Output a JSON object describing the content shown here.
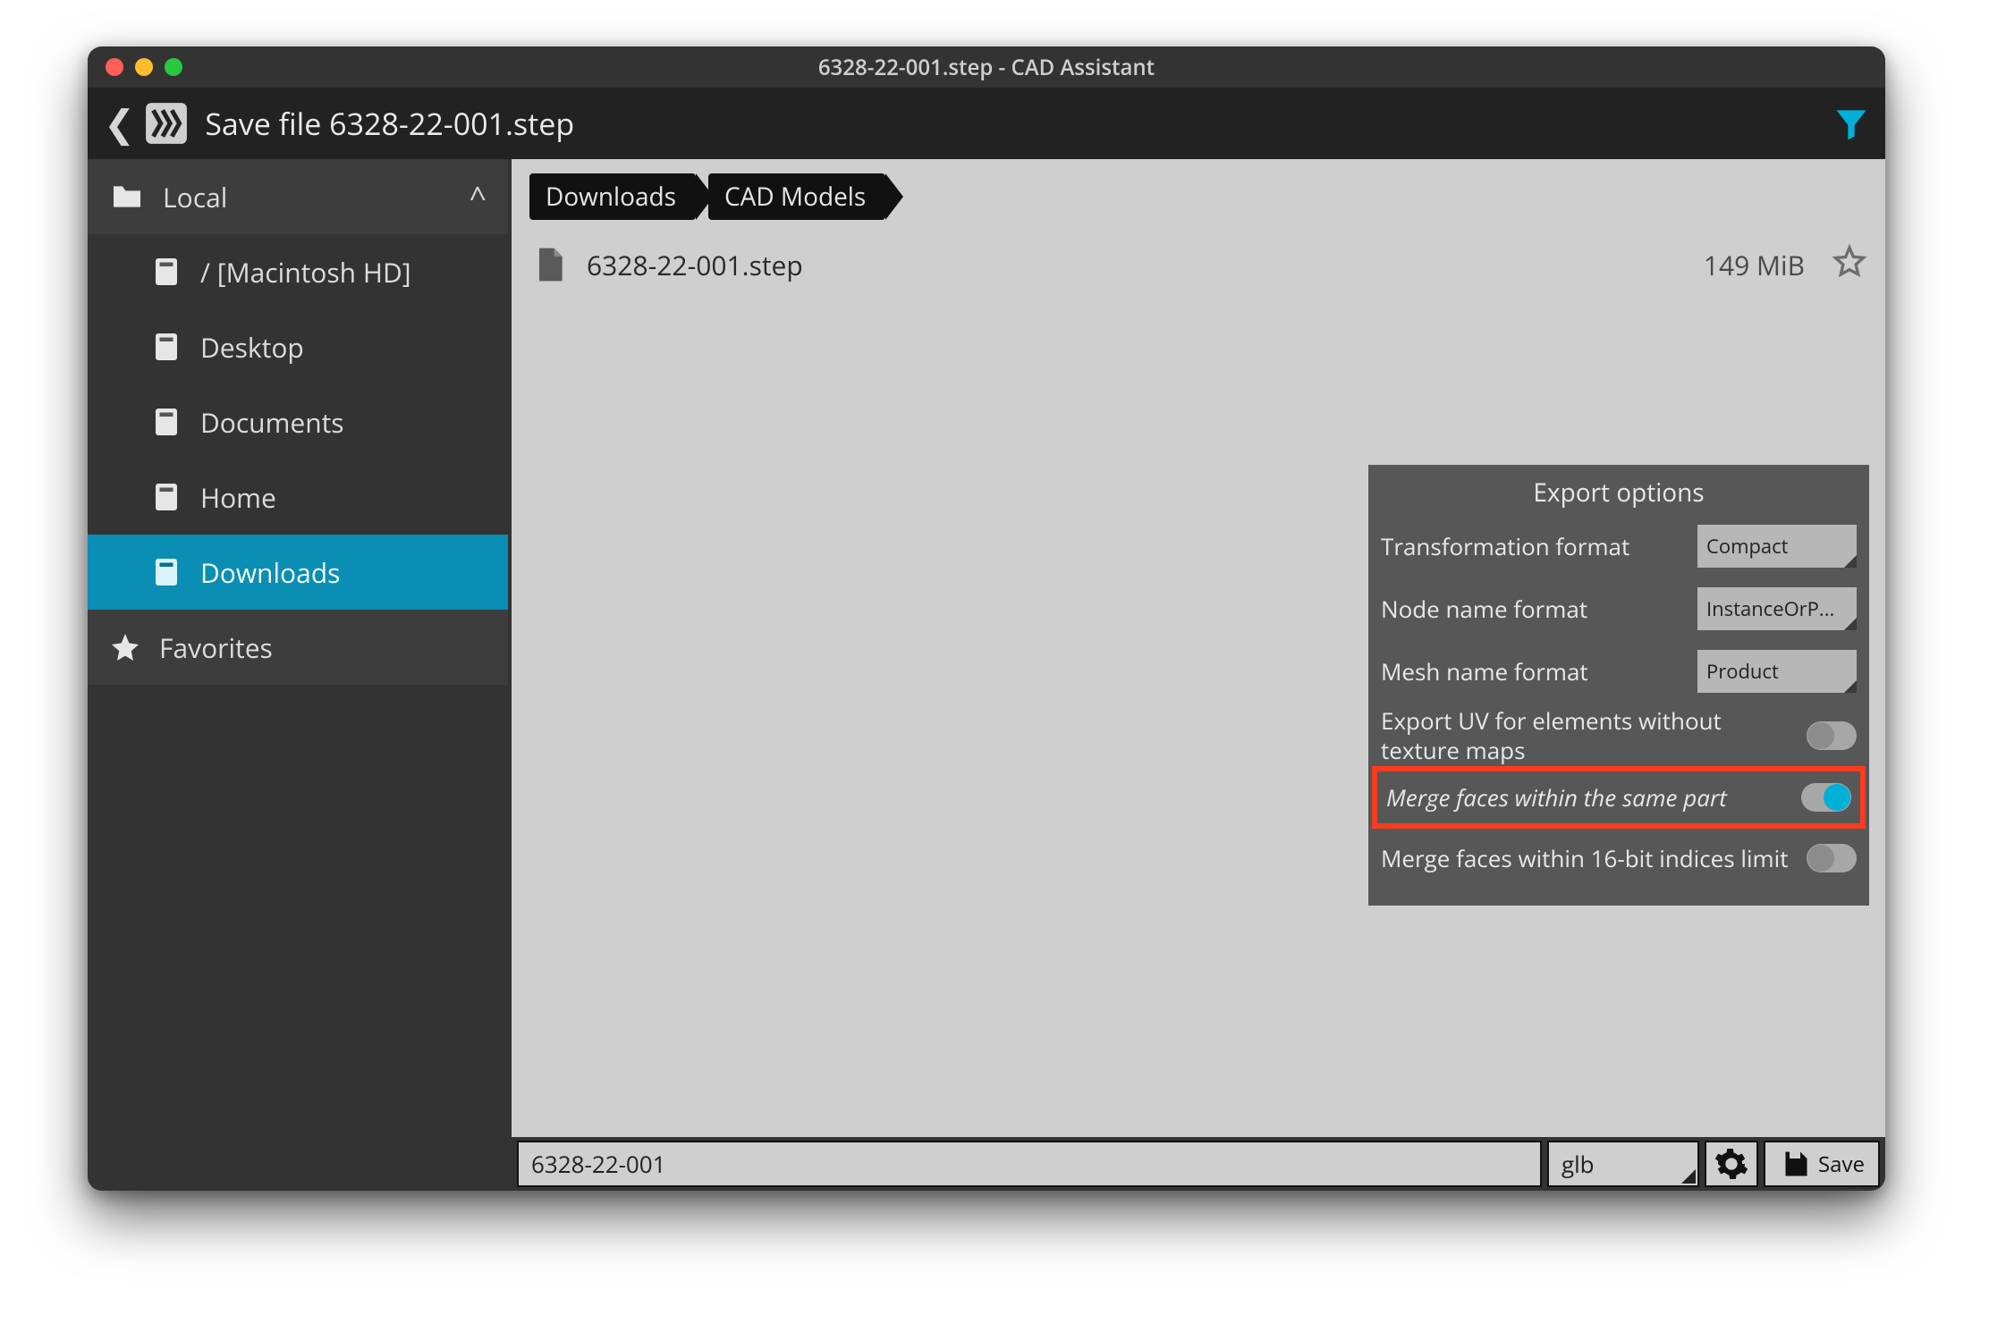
{
  "window": {
    "title": "6328-22-001.step - CAD Assistant"
  },
  "header": {
    "title": "Save file 6328-22-001.step"
  },
  "sidebar": {
    "root": {
      "label": "Local"
    },
    "items": [
      {
        "label": "/ [Macintosh HD]"
      },
      {
        "label": "Desktop"
      },
      {
        "label": "Documents"
      },
      {
        "label": "Home"
      },
      {
        "label": "Downloads"
      }
    ],
    "favorites": {
      "label": "Favorites"
    }
  },
  "breadcrumbs": [
    "Downloads",
    "CAD Models"
  ],
  "files": [
    {
      "name": "6328-22-001.step",
      "size": "149 MiB"
    }
  ],
  "export": {
    "title": "Export options",
    "rows": {
      "transformation": {
        "label": "Transformation format",
        "value": "Compact"
      },
      "node_name": {
        "label": "Node name format",
        "value": "InstanceOrP..."
      },
      "mesh_name": {
        "label": "Mesh name format",
        "value": "Product"
      },
      "export_uv": {
        "label": "Export UV for elements without texture maps"
      },
      "merge_same": {
        "label": "Merge faces within the same part"
      },
      "merge_16": {
        "label": "Merge faces within 16-bit indices limit"
      }
    }
  },
  "footer": {
    "filename": "6328-22-001",
    "format": "glb",
    "save_label": "Save"
  }
}
